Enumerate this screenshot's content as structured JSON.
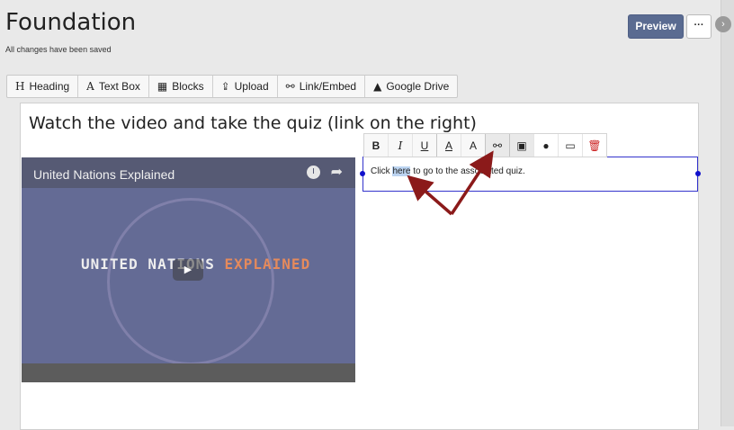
{
  "header": {
    "title": "Foundation",
    "saved_status": "All changes have been saved",
    "preview_label": "Preview",
    "more_label": "···"
  },
  "rail": {
    "toggle_icon": "chevron-right-icon",
    "toggle_glyph": "›"
  },
  "toolbar": {
    "items": [
      {
        "icon": "H",
        "icon_name": "heading-icon",
        "label": "Heading"
      },
      {
        "icon": "A",
        "icon_name": "text-box-icon",
        "label": "Text Box"
      },
      {
        "icon": "▦",
        "icon_name": "blocks-icon",
        "label": "Blocks"
      },
      {
        "icon": "⇪",
        "icon_name": "upload-icon",
        "label": "Upload"
      },
      {
        "icon": "⚯",
        "icon_name": "link-icon",
        "label": "Link/Embed"
      },
      {
        "icon": "▲",
        "icon_name": "google-drive-icon",
        "label": "Google Drive"
      }
    ]
  },
  "canvas": {
    "heading": "Watch the video and take the quiz (link on the right)",
    "video": {
      "title": "United Nations Explained",
      "caption_white": "UNITED NATIONS ",
      "caption_orange": "EXPLAINED",
      "play_glyph": "▶"
    },
    "textblock": {
      "before": "Click ",
      "link": "here",
      "after": " to go to the associated quiz."
    }
  },
  "format_toolbar": {
    "bold": "B",
    "italic": "I",
    "underline": "U",
    "text_color": "A",
    "text_highlight": "A",
    "link": "⚯",
    "image": "▣",
    "fill": "●",
    "card": "▭",
    "trash": "🗑"
  },
  "colors": {
    "accent": "#5a6b91",
    "arrow": "#8b1a1a",
    "selection_border": "#3333cc",
    "delete": "#cc2222"
  }
}
